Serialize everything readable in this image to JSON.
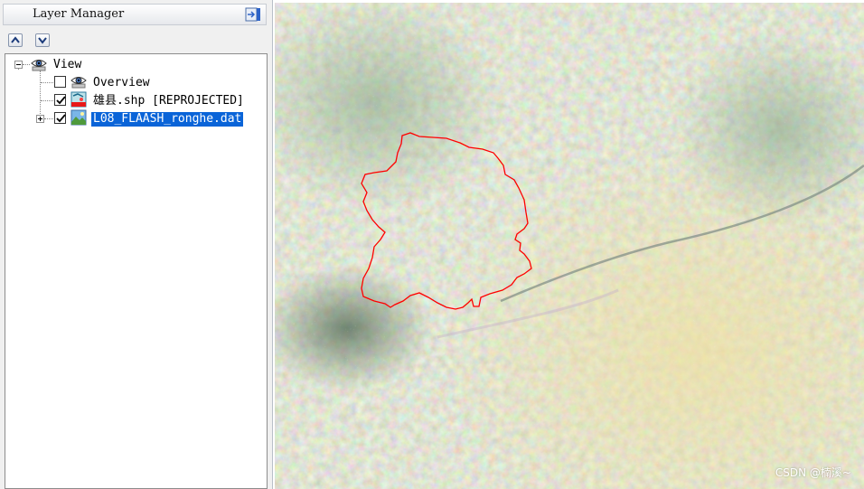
{
  "layer_manager": {
    "title": "Layer Manager",
    "dock_icon": "dock-panel-icon",
    "move_up_icon": "move-up-icon",
    "move_down_icon": "move-down-icon",
    "tree": {
      "root": {
        "label": "View",
        "expanded": true,
        "icon": "eye-icon"
      },
      "items": [
        {
          "label": "Overview",
          "checked": false,
          "icon": "eye-icon"
        },
        {
          "label": "雄县.shp [REPROJECTED]",
          "checked": true,
          "icon": "vector-layer-icon"
        },
        {
          "label": "L08_FLAASH_ronghe.dat",
          "checked": true,
          "selected": true,
          "icon": "raster-layer-icon",
          "expandable": true
        }
      ]
    }
  },
  "map": {
    "boundary_color": "#ff0000",
    "watermark": "CSDN @楠溪~"
  }
}
